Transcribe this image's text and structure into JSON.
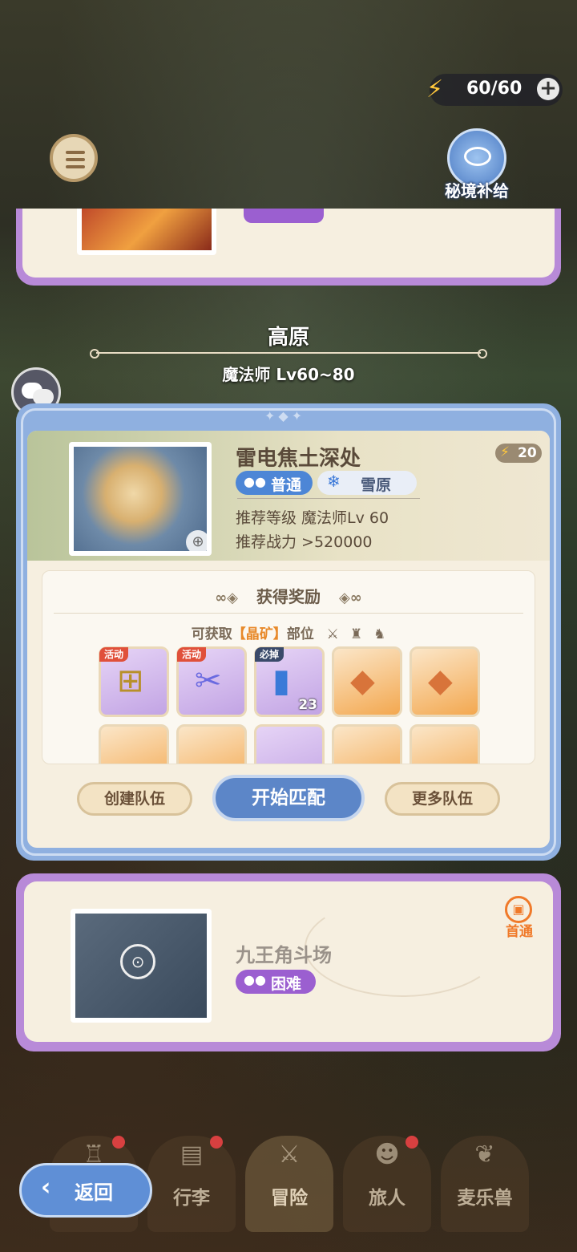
{
  "top_bar": {
    "energy": "60/60",
    "energy_plus": "+",
    "supply_label": "秘境补给"
  },
  "section": {
    "title": "高原",
    "subtitle": "魔法师  Lv60~80"
  },
  "main_card": {
    "stage_name": "雷电焦土深处",
    "cost": "20",
    "difficulty": "普通",
    "terrain": "雪原",
    "recommend_level": "推荐等级 魔法师Lv  60",
    "recommend_power": "推荐战力  >520000",
    "reward_title": "获得奖励",
    "avail_prefix": "可获取",
    "avail_highlight": "【晶矿】",
    "avail_suffix": "部位",
    "items": [
      {
        "tag": "活动",
        "count": ""
      },
      {
        "tag": "活动",
        "count": ""
      },
      {
        "tag": "必掉",
        "count": "23"
      },
      {
        "tag": "",
        "count": ""
      },
      {
        "tag": "",
        "count": ""
      }
    ],
    "buttons": {
      "create": "创建队伍",
      "start": "开始匹配",
      "more": "更多队伍"
    }
  },
  "locked_card": {
    "stage_name": "九王角斗场",
    "difficulty": "困难",
    "first_clear": "首通"
  },
  "bottom_nav": [
    {
      "label": ""
    },
    {
      "label": "行李"
    },
    {
      "label": "冒险"
    },
    {
      "label": "旅人"
    },
    {
      "label": "麦乐兽"
    }
  ],
  "back_button": "返回"
}
